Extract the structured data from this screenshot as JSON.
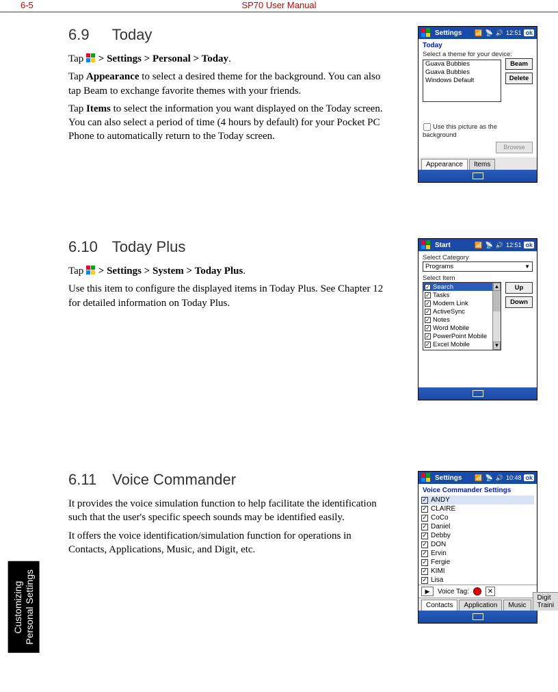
{
  "header": {
    "page": "6-5",
    "title": "SP70 User Manual"
  },
  "side_tab": {
    "line1": "Customizing",
    "line2": "Personal Settings"
  },
  "sec1": {
    "num": "6.9",
    "title": "Today",
    "p1_a": "Tap ",
    "p1_b": " > Settings > Personal > Today",
    "p1_c": ".",
    "p2_a": "Tap ",
    "p2_b": "Appearance",
    "p2_c": " to select a desired theme for the background. You can also tap Beam to exchange favorite themes with your friends.",
    "p3_a": "Tap ",
    "p3_b": "Items",
    "p3_c": " to select the information you want displayed on the Today screen. You can also select a period of time (4 hours by default) for your Pocket PC Phone to automatically return to the Today screen.",
    "shot": {
      "titlebar": {
        "label": "Settings",
        "time": "12:51",
        "ok": "ok"
      },
      "sub": "Today",
      "prompt": "Select a theme for your device:",
      "themes": [
        "Guava Bubbles",
        "Guava Bubbles",
        "Windows Default"
      ],
      "btn_beam": "Beam",
      "btn_delete": "Delete",
      "chk_label": "Use this picture as the background",
      "btn_browse": "Browse",
      "tabs": {
        "a": "Appearance",
        "b": "Items"
      }
    }
  },
  "sec2": {
    "num": "6.10",
    "title": "Today Plus",
    "p1_a": "Tap ",
    "p1_b": " > Settings > System > Today Plus",
    "p1_c": ".",
    "p2": "Use this item to configure the displayed items in Today Plus. See Chapter 12 for detailed information on Today Plus.",
    "shot": {
      "titlebar": {
        "label": "Start",
        "time": "12:51",
        "ok": "ok"
      },
      "cat_label": "Select Category",
      "cat_value": "Programs",
      "item_label": "Select Item",
      "items": [
        "Search",
        "Tasks",
        "Modem Link",
        "ActiveSync",
        "Notes",
        "Word Mobile",
        "PowerPoint Mobile",
        "Excel Mobile"
      ],
      "btn_up": "Up",
      "btn_down": "Down"
    }
  },
  "sec3": {
    "num": "6.11",
    "title": "Voice Commander",
    "p1": "It provides the voice simulation function to help facilitate the identification such that the user's specific speech sounds may be identified easily.",
    "p2": "It offers the voice identification/simulation function for operations in Contacts, Applications, Music, and Digit, etc.",
    "shot": {
      "titlebar": {
        "label": "Settings",
        "time": "10:48",
        "ok": "ok"
      },
      "sub": "Voice Commander Settings",
      "items": [
        "ANDY",
        "CLAIRE",
        "CoCo",
        "Daniel",
        "Debby",
        "DON",
        "Ervin",
        "Fergie",
        "KIMI",
        "Lisa"
      ],
      "voicetag_label": "Voice Tag:",
      "tabs": [
        "Contacts",
        "Application",
        "Music",
        "Digit Traini"
      ]
    }
  }
}
